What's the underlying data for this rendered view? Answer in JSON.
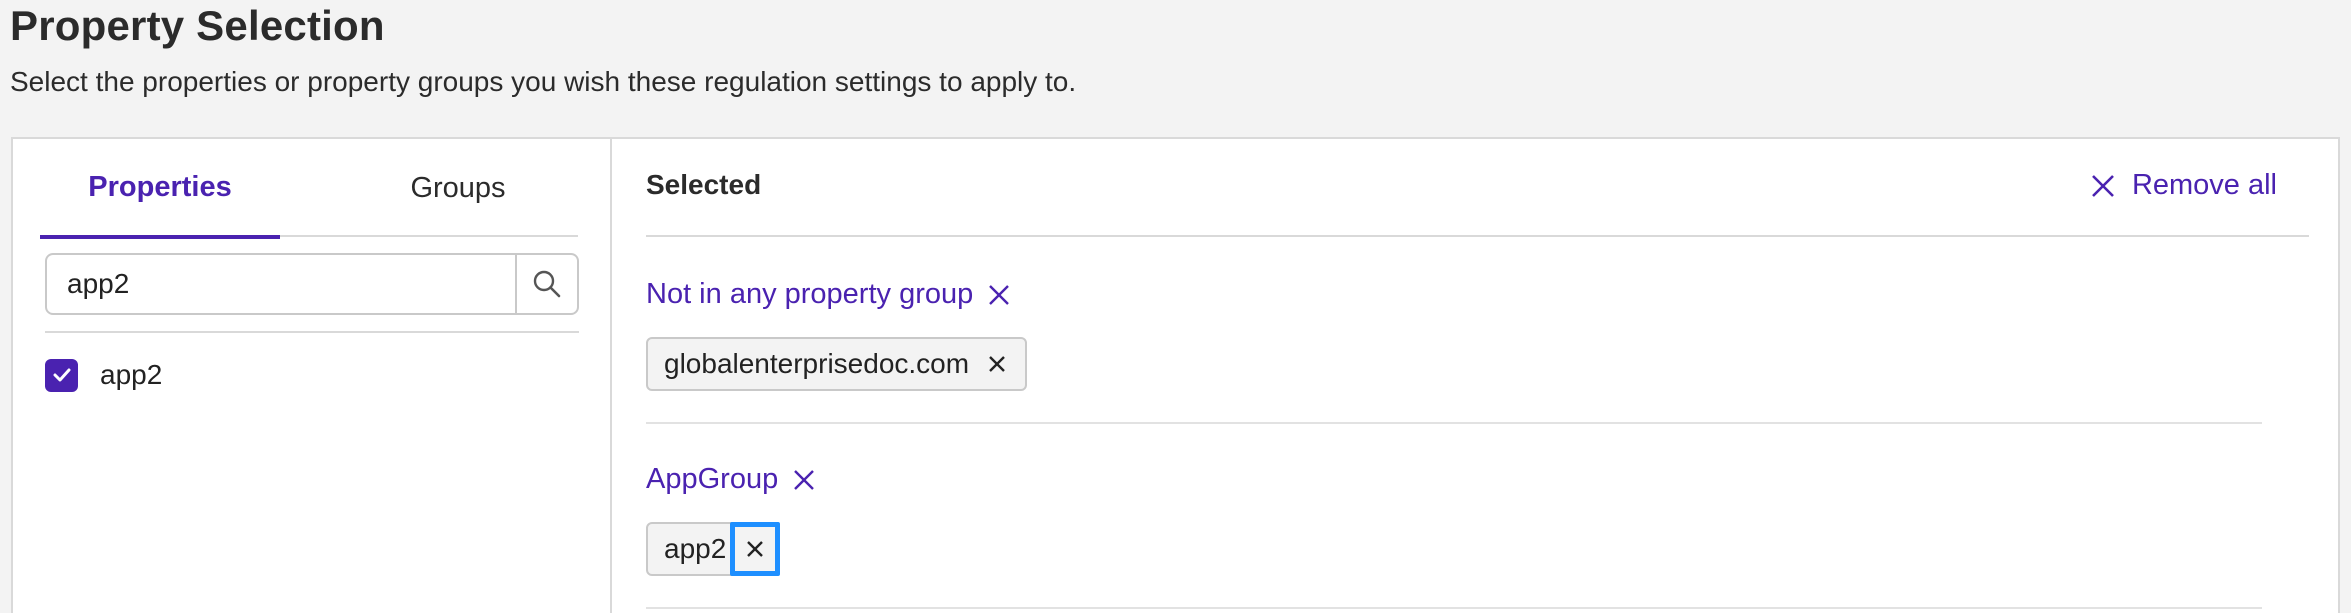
{
  "page": {
    "title": "Property Selection",
    "subtitle": "Select the properties or property groups you wish these regulation settings to apply to."
  },
  "tabs": [
    {
      "label": "Properties",
      "active": true
    },
    {
      "label": "Groups",
      "active": false
    }
  ],
  "search": {
    "value": "app2",
    "icon": "search-icon"
  },
  "results": [
    {
      "label": "app2",
      "checked": true
    }
  ],
  "selected": {
    "title": "Selected",
    "remove_all_label": "Remove all",
    "groups": [
      {
        "name": "Not in any property group",
        "items": [
          "globalenterprisedoc.com"
        ]
      },
      {
        "name": "AppGroup",
        "items": [
          "app2"
        ]
      }
    ]
  },
  "colors": {
    "accent": "#4a22b0",
    "focus": "#1e8fff",
    "border": "#d9d9d9"
  }
}
